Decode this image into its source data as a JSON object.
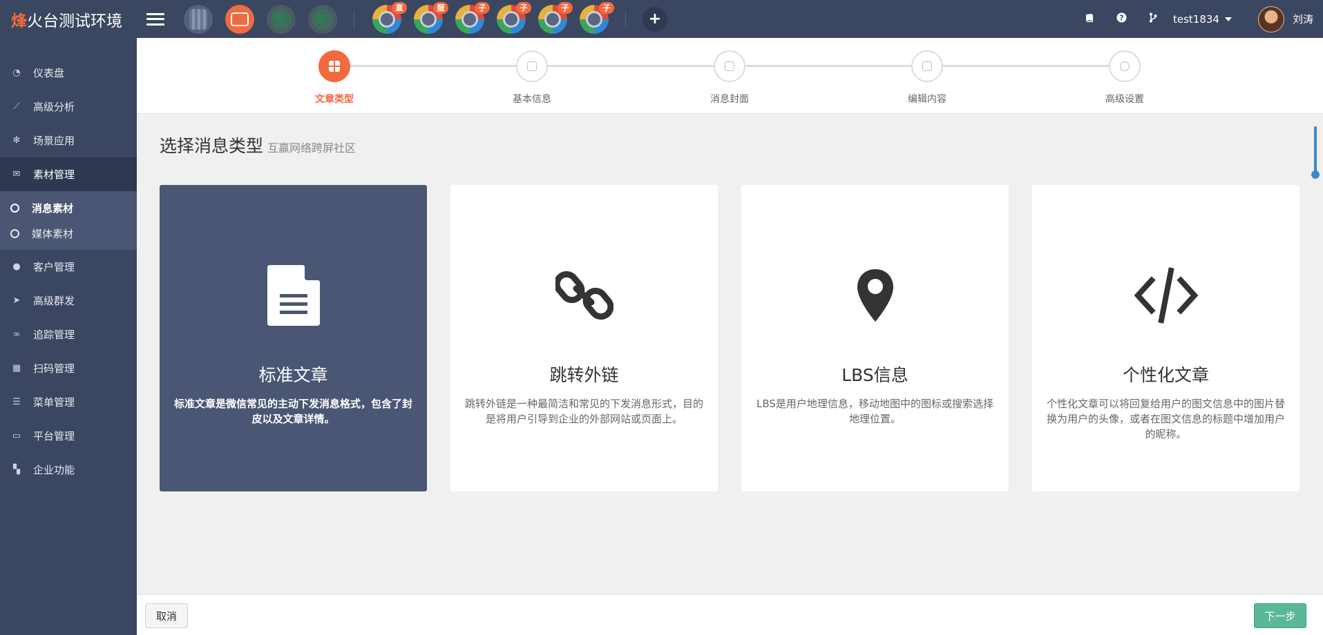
{
  "topbar": {
    "brand_accent": "烽",
    "brand_rest": "火台测试环境",
    "accounts": [
      {
        "icon": "grey-account-avatar"
      },
      {
        "icon": "orange-account-avatar"
      },
      {
        "icon": "wechat-account-avatar"
      },
      {
        "icon": "wechat-account-avatar"
      }
    ],
    "wheels": [
      {
        "badge": "直"
      },
      {
        "badge": "服"
      },
      {
        "badge": "子"
      },
      {
        "badge": "子"
      },
      {
        "badge": "子"
      },
      {
        "badge": "子"
      }
    ],
    "add_label": "+",
    "right_icons": [
      "book-icon",
      "help-icon",
      "branch-icon"
    ],
    "username": "test1834",
    "display_name": "刘涛"
  },
  "sidebar": {
    "items": [
      {
        "label": "仪表盘",
        "icon": "dashboard-icon",
        "glyph": "◔"
      },
      {
        "label": "高级分析",
        "icon": "line-chart-icon",
        "glyph": "⟋"
      },
      {
        "label": "场景应用",
        "icon": "gear-icon",
        "glyph": "✻"
      },
      {
        "label": "素材管理",
        "icon": "envelope-icon",
        "glyph": "✉",
        "active": true
      },
      {
        "label": "客户管理",
        "icon": "user-icon",
        "glyph": "●"
      },
      {
        "label": "高级群发",
        "icon": "paper-plane-icon",
        "glyph": "➤"
      },
      {
        "label": "追踪管理",
        "icon": "link-icon",
        "glyph": "∞"
      },
      {
        "label": "扫码管理",
        "icon": "qrcode-icon",
        "glyph": "▦"
      },
      {
        "label": "菜单管理",
        "icon": "list-icon",
        "glyph": "☰"
      },
      {
        "label": "平台管理",
        "icon": "desktop-icon",
        "glyph": "▭"
      },
      {
        "label": "企业功能",
        "icon": "grid-icon",
        "glyph": "▚"
      }
    ],
    "sub_items": [
      {
        "label": "消息素材",
        "active": true
      },
      {
        "label": "媒体素材",
        "active": false
      }
    ]
  },
  "steps": [
    {
      "label": "文章类型",
      "active": true
    },
    {
      "label": "基本信息"
    },
    {
      "label": "消息封面"
    },
    {
      "label": "编辑内容"
    },
    {
      "label": "高级设置"
    }
  ],
  "section": {
    "title": "选择消息类型",
    "subtitle": "互赢网络跨屏社区"
  },
  "cards": [
    {
      "title": "标准文章",
      "desc": "标准文章是微信常见的主动下发消息格式，包含了封皮以及文章详情。",
      "icon": "document-icon",
      "selected": true
    },
    {
      "title": "跳转外链",
      "desc": "跳转外链是一种最简洁和常见的下发消息形式，目的是将用户引导到企业的外部网站或页面上。",
      "icon": "chain-link-icon"
    },
    {
      "title": "LBS信息",
      "desc": "LBS是用户地理信息，移动地图中的图标或搜索选择地理位置。",
      "icon": "map-marker-icon"
    },
    {
      "title": "个性化文章",
      "desc": "个性化文章可以将回复给用户的图文信息中的图片替换为用户的头像，或者在图文信息的标题中增加用户的昵称。",
      "icon": "code-icon"
    }
  ],
  "footer": {
    "cancel_label": "取消",
    "next_label": "下一步"
  },
  "colors": {
    "accent": "#f26a3d",
    "nav_bg": "#3b4660",
    "selected_card": "#4a5673",
    "next_button": "#5ab898"
  }
}
